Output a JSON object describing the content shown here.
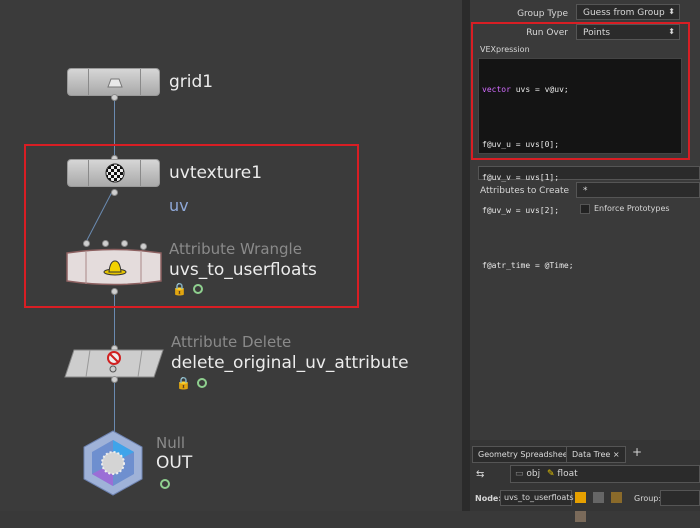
{
  "network": {
    "nodes": [
      {
        "name": "grid1",
        "type": ""
      },
      {
        "name": "uvtexture1",
        "type": "",
        "sublabel": "uv"
      },
      {
        "name": "uvs_to_userfloats",
        "type": "Attribute Wrangle"
      },
      {
        "name": "delete_original_uv_attribute",
        "type": "Attribute Delete"
      },
      {
        "name": "OUT",
        "type": "Null"
      }
    ]
  },
  "params": {
    "group_type_label": "Group Type",
    "group_type_value": "Guess from Group",
    "run_over_label": "Run Over",
    "run_over_value": "Points",
    "vexpression_label": "VEXpression",
    "code_lines": [
      {
        "kw": "vector",
        "rest": " uvs = v@uv;"
      },
      {
        "kw": "",
        "rest": ""
      },
      {
        "kw": "",
        "rest": "f@uv_u = uvs[0];"
      },
      {
        "kw": "",
        "rest": "f@uv_v = uvs[1];"
      },
      {
        "kw": "",
        "rest": "f@uv_w = uvs[2];"
      },
      {
        "kw": "",
        "rest": ""
      },
      {
        "kw": "",
        "rest": "f@atr_time = @Time;"
      }
    ],
    "attrs_label": "Attributes to Create",
    "attrs_value": "*",
    "enforce_label": "Enforce Prototypes"
  },
  "spreadsheet": {
    "tab1": "Geometry Spreadsheet",
    "tab2": "Data Tree",
    "add": "+",
    "path_obj": "obj",
    "path_node": "float",
    "node_label": "Node:",
    "node_value": "uvs_to_userfloats",
    "group_label": "Group:"
  },
  "colors": {
    "highlight": "#d81e24",
    "wire": "#6a8ab0",
    "keyword": "#d26cff"
  }
}
